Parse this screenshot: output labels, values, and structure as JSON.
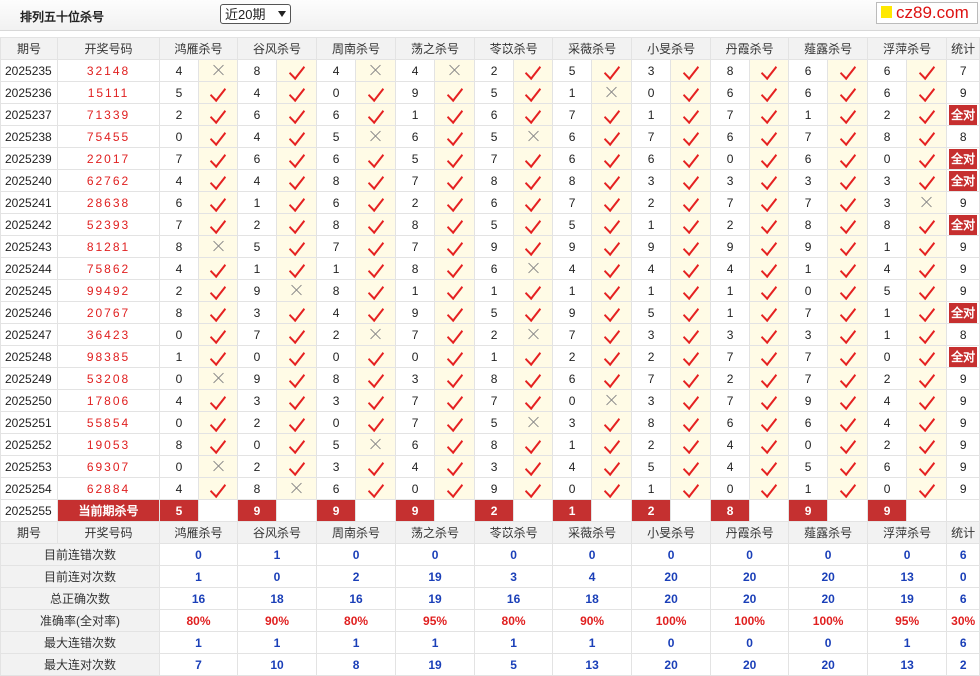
{
  "page": {
    "title": "排列五十位杀号",
    "period_select": "近20期",
    "logo": "cz89.com"
  },
  "columns": [
    "期号",
    "开奖号码",
    "鸿雁杀号",
    "谷风杀号",
    "周南杀号",
    "荡之杀号",
    "苓苡杀号",
    "采薇杀号",
    "小旻杀号",
    "丹霞杀号",
    "薤露杀号",
    "浮萍杀号",
    "统计"
  ],
  "rows": [
    {
      "period": "2025235",
      "draw": "32148",
      "kills": [
        "4",
        "8",
        "4",
        "4",
        "2",
        "5",
        "3",
        "8",
        "6",
        "6"
      ],
      "marks": [
        0,
        1,
        0,
        0,
        1,
        1,
        1,
        1,
        1,
        1
      ],
      "count": "7"
    },
    {
      "period": "2025236",
      "draw": "15111",
      "kills": [
        "5",
        "4",
        "0",
        "9",
        "5",
        "1",
        "0",
        "6",
        "6",
        "6"
      ],
      "marks": [
        1,
        1,
        1,
        1,
        1,
        0,
        1,
        1,
        1,
        1
      ],
      "count": "9"
    },
    {
      "period": "2025237",
      "draw": "71339",
      "kills": [
        "2",
        "6",
        "6",
        "1",
        "6",
        "7",
        "1",
        "7",
        "1",
        "2"
      ],
      "marks": [
        1,
        1,
        1,
        1,
        1,
        1,
        1,
        1,
        1,
        1
      ],
      "count": "全对"
    },
    {
      "period": "2025238",
      "draw": "75455",
      "kills": [
        "0",
        "4",
        "5",
        "6",
        "5",
        "6",
        "7",
        "6",
        "7",
        "8"
      ],
      "marks": [
        1,
        1,
        0,
        1,
        0,
        1,
        1,
        1,
        1,
        1
      ],
      "count": "8"
    },
    {
      "period": "2025239",
      "draw": "22017",
      "kills": [
        "7",
        "6",
        "6",
        "5",
        "7",
        "6",
        "6",
        "0",
        "6",
        "0"
      ],
      "marks": [
        1,
        1,
        1,
        1,
        1,
        1,
        1,
        1,
        1,
        1
      ],
      "count": "全对"
    },
    {
      "period": "2025240",
      "draw": "62762",
      "kills": [
        "4",
        "4",
        "8",
        "7",
        "8",
        "8",
        "3",
        "3",
        "3",
        "3"
      ],
      "marks": [
        1,
        1,
        1,
        1,
        1,
        1,
        1,
        1,
        1,
        1
      ],
      "count": "全对"
    },
    {
      "period": "2025241",
      "draw": "28638",
      "kills": [
        "6",
        "1",
        "6",
        "2",
        "6",
        "7",
        "2",
        "7",
        "7",
        "3"
      ],
      "marks": [
        1,
        1,
        1,
        1,
        1,
        1,
        1,
        1,
        1,
        0
      ],
      "count": "9"
    },
    {
      "period": "2025242",
      "draw": "52393",
      "kills": [
        "7",
        "2",
        "8",
        "8",
        "5",
        "5",
        "1",
        "2",
        "8",
        "8"
      ],
      "marks": [
        1,
        1,
        1,
        1,
        1,
        1,
        1,
        1,
        1,
        1
      ],
      "count": "全对"
    },
    {
      "period": "2025243",
      "draw": "81281",
      "kills": [
        "8",
        "5",
        "7",
        "7",
        "9",
        "9",
        "9",
        "9",
        "9",
        "1"
      ],
      "marks": [
        0,
        1,
        1,
        1,
        1,
        1,
        1,
        1,
        1,
        1
      ],
      "count": "9"
    },
    {
      "period": "2025244",
      "draw": "75862",
      "kills": [
        "4",
        "1",
        "1",
        "8",
        "6",
        "4",
        "4",
        "4",
        "1",
        "4"
      ],
      "marks": [
        1,
        1,
        1,
        1,
        0,
        1,
        1,
        1,
        1,
        1
      ],
      "count": "9"
    },
    {
      "period": "2025245",
      "draw": "99492",
      "kills": [
        "2",
        "9",
        "8",
        "1",
        "1",
        "1",
        "1",
        "1",
        "0",
        "5"
      ],
      "marks": [
        1,
        0,
        1,
        1,
        1,
        1,
        1,
        1,
        1,
        1
      ],
      "count": "9"
    },
    {
      "period": "2025246",
      "draw": "20767",
      "kills": [
        "8",
        "3",
        "4",
        "9",
        "5",
        "9",
        "5",
        "1",
        "7",
        "1"
      ],
      "marks": [
        1,
        1,
        1,
        1,
        1,
        1,
        1,
        1,
        1,
        1
      ],
      "count": "全对"
    },
    {
      "period": "2025247",
      "draw": "36423",
      "kills": [
        "0",
        "7",
        "2",
        "7",
        "2",
        "7",
        "3",
        "3",
        "3",
        "1"
      ],
      "marks": [
        1,
        1,
        0,
        1,
        0,
        1,
        1,
        1,
        1,
        1
      ],
      "count": "8"
    },
    {
      "period": "2025248",
      "draw": "98385",
      "kills": [
        "1",
        "0",
        "0",
        "0",
        "1",
        "2",
        "2",
        "7",
        "7",
        "0"
      ],
      "marks": [
        1,
        1,
        1,
        1,
        1,
        1,
        1,
        1,
        1,
        1
      ],
      "count": "全对"
    },
    {
      "period": "2025249",
      "draw": "53208",
      "kills": [
        "0",
        "9",
        "8",
        "3",
        "8",
        "6",
        "7",
        "2",
        "7",
        "2"
      ],
      "marks": [
        0,
        1,
        1,
        1,
        1,
        1,
        1,
        1,
        1,
        1
      ],
      "count": "9"
    },
    {
      "period": "2025250",
      "draw": "17806",
      "kills": [
        "4",
        "3",
        "3",
        "7",
        "7",
        "0",
        "3",
        "7",
        "9",
        "4"
      ],
      "marks": [
        1,
        1,
        1,
        1,
        1,
        0,
        1,
        1,
        1,
        1
      ],
      "count": "9"
    },
    {
      "period": "2025251",
      "draw": "55854",
      "kills": [
        "0",
        "2",
        "0",
        "7",
        "5",
        "3",
        "8",
        "6",
        "6",
        "4"
      ],
      "marks": [
        1,
        1,
        1,
        1,
        0,
        1,
        1,
        1,
        1,
        1
      ],
      "count": "9"
    },
    {
      "period": "2025252",
      "draw": "19053",
      "kills": [
        "8",
        "0",
        "5",
        "6",
        "8",
        "1",
        "2",
        "4",
        "0",
        "2"
      ],
      "marks": [
        1,
        1,
        0,
        1,
        1,
        1,
        1,
        1,
        1,
        1
      ],
      "count": "9"
    },
    {
      "period": "2025253",
      "draw": "69307",
      "kills": [
        "0",
        "2",
        "3",
        "4",
        "3",
        "4",
        "5",
        "4",
        "5",
        "6"
      ],
      "marks": [
        0,
        1,
        1,
        1,
        1,
        1,
        1,
        1,
        1,
        1
      ],
      "count": "9"
    },
    {
      "period": "2025254",
      "draw": "62884",
      "kills": [
        "4",
        "8",
        "6",
        "0",
        "9",
        "0",
        "1",
        "0",
        "1",
        "0"
      ],
      "marks": [
        1,
        0,
        1,
        1,
        1,
        1,
        1,
        1,
        1,
        1
      ],
      "count": "9"
    }
  ],
  "current": {
    "period": "2025255",
    "label": "当前期杀号",
    "kills": [
      "5",
      "9",
      "9",
      "9",
      "2",
      "1",
      "2",
      "8",
      "9",
      "9"
    ]
  },
  "stats": [
    {
      "label": "目前连错次数",
      "values": [
        "0",
        "1",
        "0",
        "0",
        "0",
        "0",
        "0",
        "0",
        "0",
        "0",
        "6"
      ],
      "accent": false
    },
    {
      "label": "目前连对次数",
      "values": [
        "1",
        "0",
        "2",
        "19",
        "3",
        "4",
        "20",
        "20",
        "20",
        "13",
        "0"
      ],
      "accent": false
    },
    {
      "label": "总正确次数",
      "values": [
        "16",
        "18",
        "16",
        "19",
        "16",
        "18",
        "20",
        "20",
        "20",
        "19",
        "6"
      ],
      "accent": false
    },
    {
      "label": "准确率(全对率)",
      "values": [
        "80%",
        "90%",
        "80%",
        "95%",
        "80%",
        "90%",
        "100%",
        "100%",
        "100%",
        "95%",
        "30%"
      ],
      "accent": true
    },
    {
      "label": "最大连错次数",
      "values": [
        "1",
        "1",
        "1",
        "1",
        "1",
        "1",
        "0",
        "0",
        "0",
        "1",
        "6"
      ],
      "accent": false
    },
    {
      "label": "最大连对次数",
      "values": [
        "7",
        "10",
        "8",
        "19",
        "5",
        "13",
        "20",
        "20",
        "20",
        "13",
        "2"
      ],
      "accent": false
    }
  ]
}
